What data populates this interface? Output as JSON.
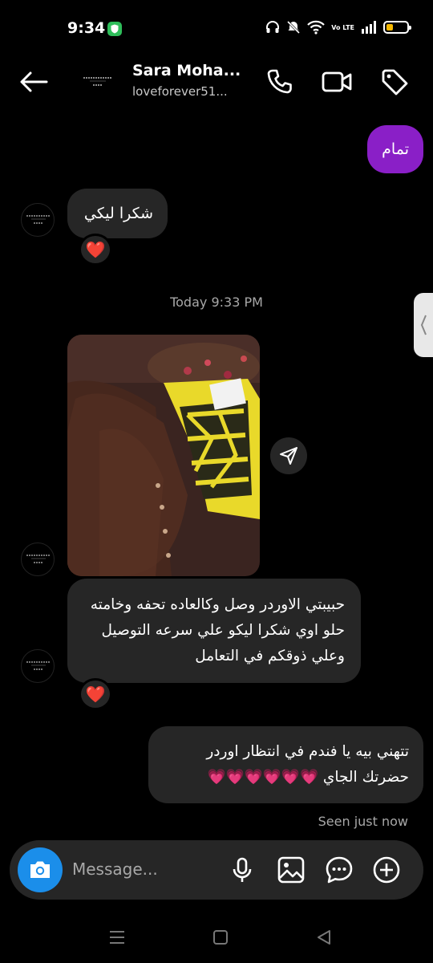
{
  "status": {
    "time": "9:34",
    "network": "Vo LTE",
    "battery_level": 0.35,
    "battery_color": "#f5b800"
  },
  "header": {
    "name": "Sara Moha...",
    "username": "loveforever51...",
    "icons": [
      "back-arrow-icon",
      "phone-icon",
      "video-camera-icon",
      "tag-icon"
    ]
  },
  "messages": {
    "m1": "تمام",
    "m2": "شكرا ليكي",
    "m2_reaction": "❤️",
    "timestamp": "Today 9:33 PM",
    "m3": "حبيبتي الاوردر وصل وكالعاده تحفه وخامته حلو اوي شكرا ليكو علي سرعه التوصيل وعلي ذوقكم في التعامل",
    "m3_reaction": "❤️",
    "m4": "تتهني بيه يا فندم في انتظار اوردر حضرتك الجاي 💗💗💗💗💗💗",
    "seen": "Seen just now"
  },
  "composer": {
    "placeholder": "Message..."
  },
  "colors": {
    "purple_bubble": "#8a1fc7",
    "gray_bubble": "#262626",
    "camera_blue": "#1b8eea"
  }
}
